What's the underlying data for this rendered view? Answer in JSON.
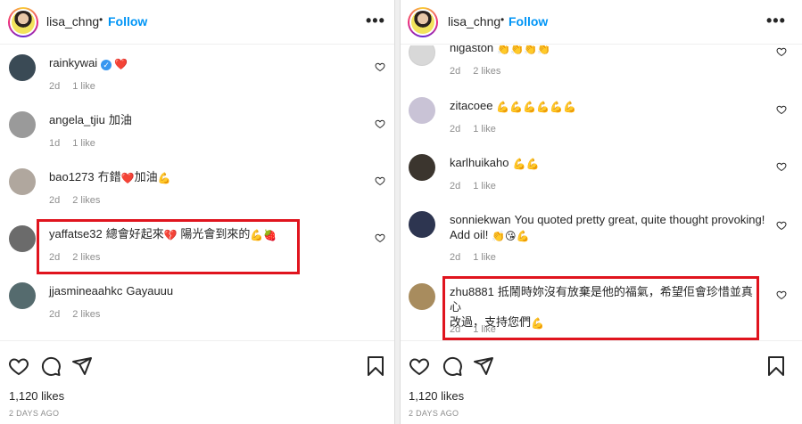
{
  "left": {
    "header": {
      "username": "lisa_chng",
      "separator": "•",
      "follow_label": "Follow",
      "more_label": "•••"
    },
    "comments": [
      {
        "username": "rainkywai",
        "text": "",
        "emoji": "❤️",
        "verified": true,
        "time": "2d",
        "likes": "1 like",
        "avatar_color": "#3a4a55"
      },
      {
        "username": "angela_tjiu",
        "text": "加油",
        "emoji": "",
        "verified": false,
        "time": "1d",
        "likes": "1 like",
        "avatar_color": "#9a9a9a"
      },
      {
        "username": "bao1273",
        "text": "冇錯",
        "emoji": "❤️",
        "text2": "加油",
        "emoji2": "💪",
        "verified": false,
        "time": "2d",
        "likes": "2 likes",
        "avatar_color": "#b0a79e"
      },
      {
        "username": "yaffatse32",
        "text": "總會好起來",
        "emoji": "💔",
        "text2": " 陽光會到來的",
        "emoji2": "💪🍓",
        "verified": false,
        "time": "2d",
        "likes": "2 likes",
        "avatar_color": "#6b6b6b"
      },
      {
        "username": "jjasmineaahkc",
        "text": "Gayauuu",
        "emoji": "",
        "verified": false,
        "time": "2d",
        "likes": "2 likes",
        "avatar_color": "#556b6e"
      }
    ],
    "likes": "1,120 likes",
    "ago": "2 DAYS AGO"
  },
  "right": {
    "header": {
      "username": "lisa_chng",
      "separator": "•",
      "follow_label": "Follow",
      "more_label": "•••"
    },
    "comments": [
      {
        "username": "higaston",
        "text": "",
        "emoji": "👏👏👏👏",
        "time": "2d",
        "likes": "2 likes",
        "avatar_color": "#d8d8d8"
      },
      {
        "username": "zitacoee",
        "text": "",
        "emoji": "💪💪💪💪💪💪",
        "time": "2d",
        "likes": "1 like",
        "avatar_color": "#c9c3d6"
      },
      {
        "username": "karlhuikaho",
        "text": "",
        "emoji": "💪💪",
        "time": "2d",
        "likes": "1 like",
        "avatar_color": "#3b352e"
      },
      {
        "username": "sonniekwan",
        "text": "You quoted pretty great, quite thought provoking!",
        "text2": "Add oil!",
        "emoji": "👏😘💪",
        "time": "2d",
        "likes": "1 like",
        "avatar_color": "#2d3550"
      },
      {
        "username": "zhu8881",
        "text": "抵鬧時妳沒有放棄是他的福氣，希望佢會珍惜並真心",
        "text2": "改過，支持您們",
        "emoji": "💪",
        "time": "2d",
        "likes": "1 like",
        "avatar_color": "#a88c5e"
      }
    ],
    "likes": "1,120 likes",
    "ago": "2 DAYS AGO"
  },
  "colors": {
    "follow": "#0095f6",
    "highlight": "#e0141e",
    "meta": "#8e8e8e",
    "text": "#262626"
  },
  "icons": [
    "heart-icon",
    "comment-icon",
    "share-icon",
    "bookmark-icon",
    "more-icon",
    "verified-icon"
  ]
}
